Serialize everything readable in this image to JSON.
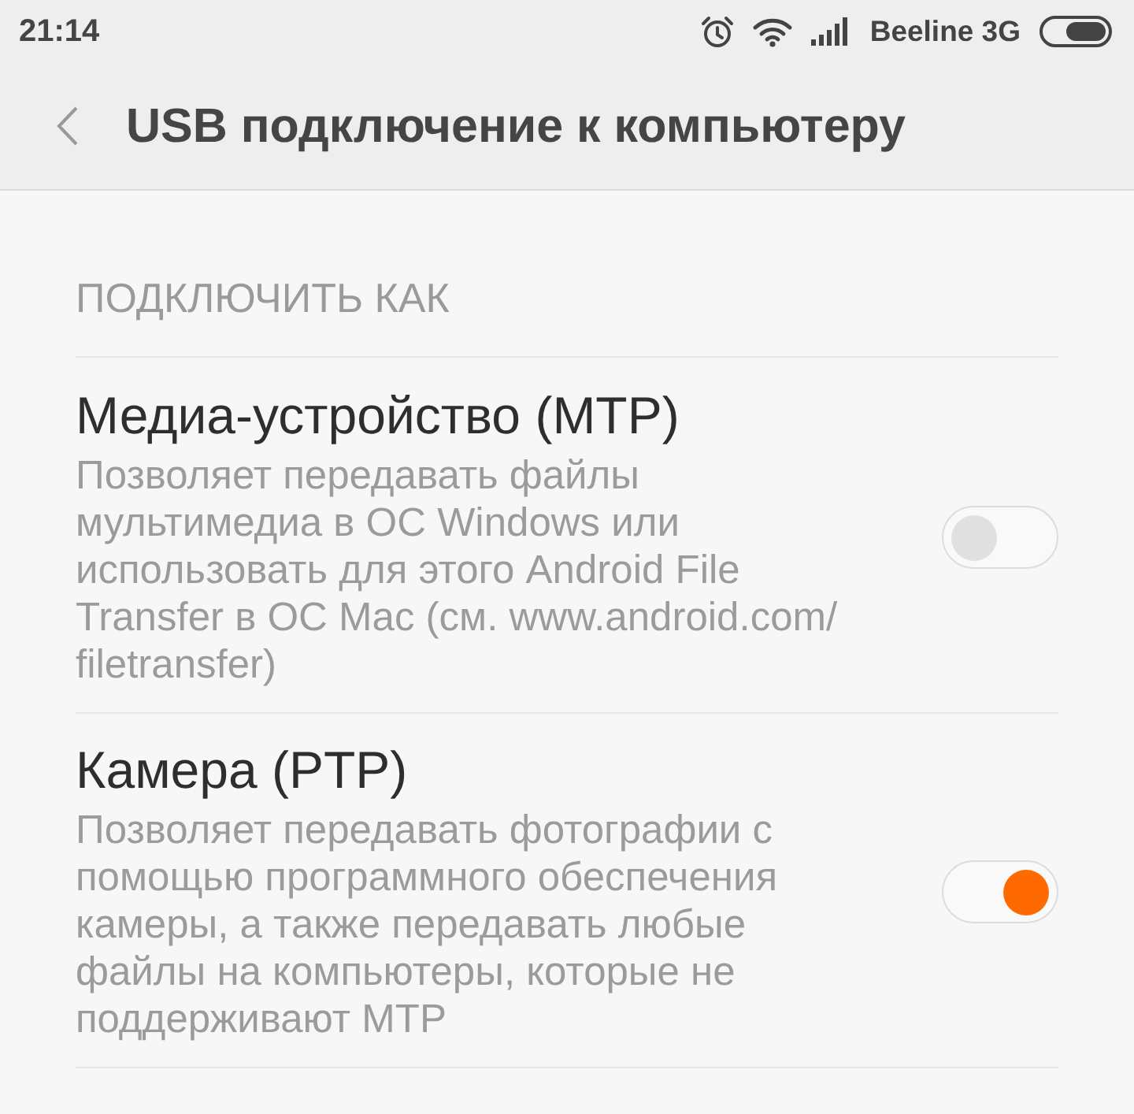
{
  "status_bar": {
    "time": "21:14",
    "carrier": "Beeline 3G"
  },
  "header": {
    "title": "USB подключение к компьютеру"
  },
  "section": {
    "heading": "ПОДКЛЮЧИТЬ КАК",
    "options": [
      {
        "title": "Медиа-устройство (MTP)",
        "description": [
          "Позволяет передавать файлы",
          "мультимедиа в ОС Windows или",
          "использовать для этого Android File",
          "Transfer в ОС Mac (см. www.android.com/",
          "filetransfer)"
        ],
        "checked": false
      },
      {
        "title": "Камера (PTP)",
        "description": [
          "Позволяет передавать фотографии с",
          "помощью программного обеспечения",
          "камеры, а также передавать любые",
          "файлы на компьютеры, которые не",
          "поддерживают MTP"
        ],
        "checked": true
      }
    ]
  }
}
